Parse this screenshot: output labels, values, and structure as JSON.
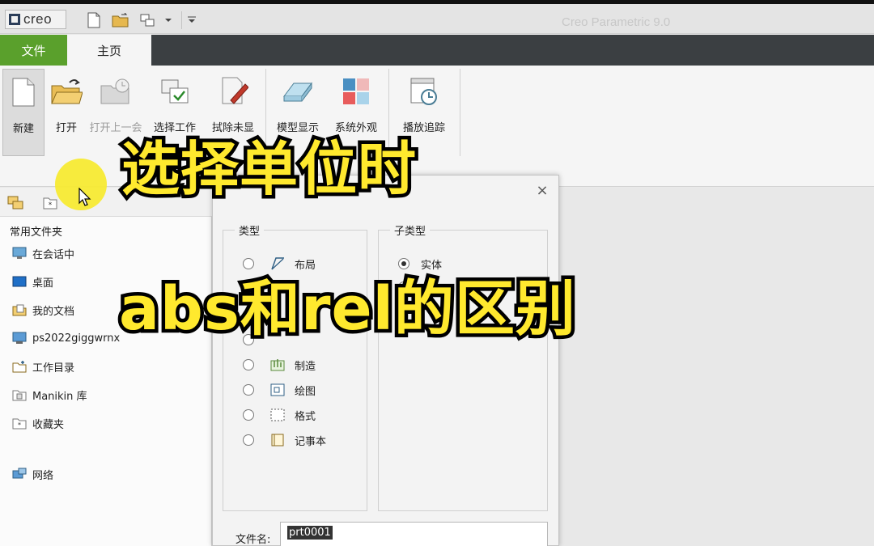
{
  "app": {
    "logo_text": "creo",
    "window_title": "Creo Parametric 9.0"
  },
  "tabs": [
    {
      "label": "文件"
    },
    {
      "label": "主页"
    }
  ],
  "ribbon": {
    "buttons": [
      {
        "label": "新建",
        "icon": "new-file-icon",
        "state": "active"
      },
      {
        "label": "打开",
        "icon": "open-folder-icon",
        "state": "normal"
      },
      {
        "label": "打开上一会",
        "icon": "open-last-session-icon",
        "state": "disabled"
      },
      {
        "label": "选择工作",
        "icon": "select-working-dir-icon",
        "state": "normal"
      },
      {
        "label": "拭除未显",
        "icon": "erase-icon",
        "state": "normal"
      },
      {
        "label": "模型显示",
        "icon": "model-display-icon",
        "state": "normal"
      },
      {
        "label": "系统外观",
        "icon": "system-appearance-icon",
        "state": "normal"
      },
      {
        "label": "播放追踪",
        "icon": "play-trail-icon",
        "state": "normal"
      }
    ]
  },
  "navigator": {
    "heading": "常用文件夹",
    "items": [
      {
        "label": "在会话中",
        "icon": "monitor-icon"
      },
      {
        "label": "桌面",
        "icon": "desktop-icon"
      },
      {
        "label": "我的文档",
        "icon": "documents-icon"
      },
      {
        "label": "ps2022giggwrnx",
        "icon": "computer-icon"
      },
      {
        "label": "工作目录",
        "icon": "working-folder-icon"
      },
      {
        "label": "Manikin 库",
        "icon": "library-icon"
      },
      {
        "label": "收藏夹",
        "icon": "favorites-icon"
      },
      {
        "label": "网络",
        "icon": "network-icon"
      }
    ]
  },
  "dialog": {
    "close_glyph": "×",
    "type_group": {
      "title": "类型",
      "options": [
        {
          "label": "布局",
          "icon": "layout-icon",
          "checked": false
        },
        {
          "label": "制造",
          "icon": "manufacturing-icon",
          "checked": false
        },
        {
          "label": "绘图",
          "icon": "drawing-icon",
          "checked": false
        },
        {
          "label": "格式",
          "icon": "format-icon",
          "checked": false
        },
        {
          "label": "记事本",
          "icon": "notebook-icon",
          "checked": false
        }
      ]
    },
    "subtype_group": {
      "title": "子类型",
      "options": [
        {
          "label": "实体",
          "checked": true
        }
      ]
    },
    "filename_label": "文件名:",
    "filename_value": "prt0001"
  },
  "overlay": {
    "caption_line1": "选择单位时",
    "caption_line2": "abs和rel的区别",
    "caption_color": "#ffe92e"
  }
}
